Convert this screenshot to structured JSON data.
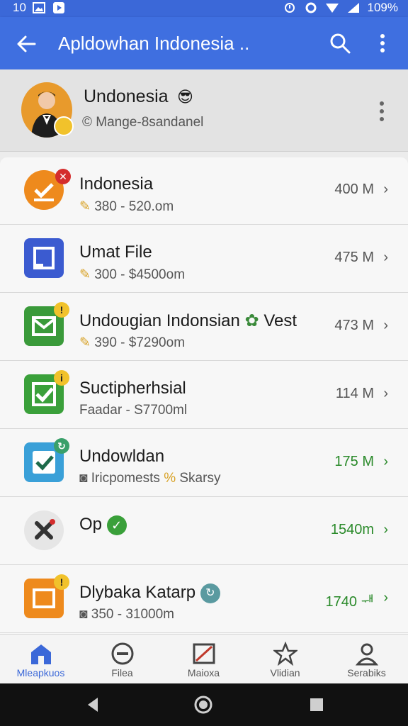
{
  "status_bar": {
    "time": "10",
    "battery": "109%"
  },
  "app_bar": {
    "title": "Apldowhan Indonesia .."
  },
  "profile": {
    "name": "Undonesia",
    "subtitle": "Mange-8sandanel"
  },
  "items": [
    {
      "title": "Indonesia",
      "subtitle": "380 - 520.om",
      "size": "400 M"
    },
    {
      "title": "Umat File",
      "subtitle": "300 - $4500om",
      "size": "475 M"
    },
    {
      "title": "Undougian Indonsian",
      "title_extra": "Vest",
      "subtitle": "390 - $7290om",
      "size": "473 M"
    },
    {
      "title": "Suctipherhsial",
      "subtitle": "Faadar - S7700ml",
      "size": "114 M"
    },
    {
      "title": "Undowldan",
      "subtitle": "Iricpomests",
      "subtitle_extra": "Skarsy",
      "size": "175 M"
    },
    {
      "title": "Op",
      "subtitle": "",
      "size": "1540m"
    },
    {
      "title": "Dlybaka Katarp",
      "subtitle": "350 - 31000m",
      "size": "1740 ᆊ"
    }
  ],
  "bottom_nav": [
    {
      "label": "Mleapkuos"
    },
    {
      "label": "Filea"
    },
    {
      "label": "Maioxa"
    },
    {
      "label": "Vlidian"
    },
    {
      "label": "Serabiks"
    }
  ],
  "colors": {
    "app_bar": "#3f6fe0",
    "accent_green": "#2a8a2a",
    "gold": "#d8a226"
  }
}
